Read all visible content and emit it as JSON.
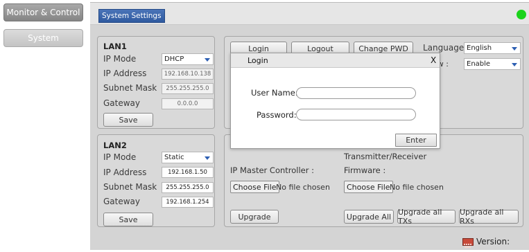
{
  "nav": {
    "monitor_control": "Monitor & Control",
    "system": "System"
  },
  "header": {
    "tab": "System Settings",
    "status_color": "#1bd31b"
  },
  "lan1": {
    "title": "LAN1",
    "ip_mode_label": "IP Mode",
    "ip_mode_value": "DHCP",
    "ip_address_label": "IP Address",
    "ip_address_value": "192.168.10.138",
    "subnet_label": "Subnet Mask",
    "subnet_value": "255.255.255.0",
    "gateway_label": "Gateway",
    "gateway_value": "0.0.0.0",
    "save": "Save"
  },
  "lan2": {
    "title": "LAN2",
    "ip_mode_label": "IP Mode",
    "ip_mode_value": "Static",
    "ip_address_label": "IP Address",
    "ip_address_value": "192.168.1.50",
    "subnet_label": "Subnet Mask",
    "subnet_value": "255.255.255.0",
    "gateway_label": "Gateway",
    "gateway_value": "192.168.1.254",
    "save": "Save"
  },
  "account": {
    "login": "Login",
    "logout": "Logout",
    "change_pwd": "Change PWD",
    "language_label": "Language :",
    "language_value": "English",
    "view_label": "ew :",
    "view_value": "Enable"
  },
  "firmware": {
    "ip_master_label": "IP Master Controller :",
    "tx_rx_label": "Transmitter/Receiver",
    "firmware_label": "Firmware :",
    "choose_file": "Choose File",
    "no_file": "No file chosen",
    "upgrade": "Upgrade",
    "upgrade_all": "Upgrade All",
    "upgrade_txs": "Upgrade all TXs",
    "upgrade_rxs": "Upgrade all RXs"
  },
  "login_dialog": {
    "title": "Login",
    "close": "X",
    "username_label": "User Name:",
    "password_label": "Password:",
    "enter": "Enter"
  },
  "footer": {
    "version_label": "Version:"
  }
}
